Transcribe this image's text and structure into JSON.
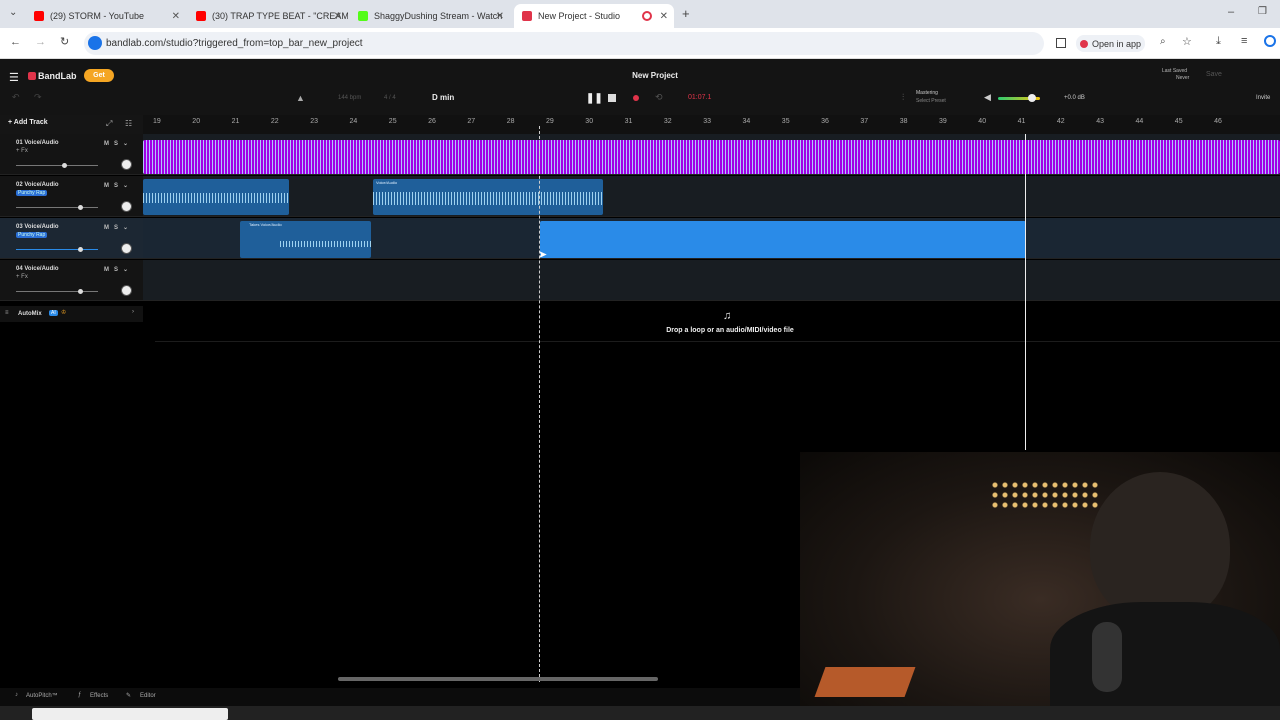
{
  "browser": {
    "tabs": [
      {
        "label": "(29) STORM - YouTube",
        "favicon_color": "#ff0000"
      },
      {
        "label": "(30) TRAP TYPE BEAT - \"CREAM\"",
        "favicon_color": "#ff0000"
      },
      {
        "label": "ShaggyDushing Stream - Watch",
        "favicon_color": "#53fc18"
      },
      {
        "label": "New Project - Studio",
        "favicon_color": "#e0344a"
      }
    ],
    "url": "bandlab.com/studio?triggered_from=top_bar_new_project",
    "open_in_app": "Open in app"
  },
  "app": {
    "logo": "BandLab",
    "get_label": "Get",
    "project_title": "New Project",
    "bpm": "144 bpm",
    "time_sig": "4 / 4",
    "key": "D min",
    "time": "01:07.1",
    "mastering": "Mastering",
    "select_preset": "Select Preset",
    "volume_db": "+0.0 dB",
    "last_saved_label": "Last Saved",
    "last_saved_value": "Never",
    "save": "Save",
    "invite": "Invite",
    "add_track": "Add Track",
    "automix": "AutoMix",
    "automix_badge": "AI",
    "drop_hint": "Drop a loop or an audio/MIDI/video file",
    "accent": "#2a8be8",
    "track_purple": "#a100e6"
  },
  "ruler": [
    "19",
    "20",
    "21",
    "22",
    "23",
    "24",
    "25",
    "26",
    "27",
    "28",
    "29",
    "30",
    "31",
    "32",
    "33",
    "34",
    "35",
    "36",
    "37",
    "38",
    "39",
    "40",
    "41",
    "42",
    "43",
    "44",
    "45",
    "46"
  ],
  "tracks": [
    {
      "name": "01 Voice/Audio",
      "fx": "+ Fx",
      "tag": ""
    },
    {
      "name": "02 Voice/Audio",
      "fx": "+ Fx",
      "tag": "Punchy Rap"
    },
    {
      "name": "03 Voice/Audio",
      "fx": "+ Fx",
      "tag": "Punchy Rap"
    },
    {
      "name": "04 Voice/Audio",
      "fx": "+ Fx",
      "tag": ""
    }
  ],
  "clips": {
    "t2_clip_label": "Voice/Audio",
    "t3_clip_label": "Takes Voice/Audio"
  },
  "footer": {
    "autopitch": "AutoPitch™",
    "effects": "Effects",
    "editor": "Editor"
  }
}
